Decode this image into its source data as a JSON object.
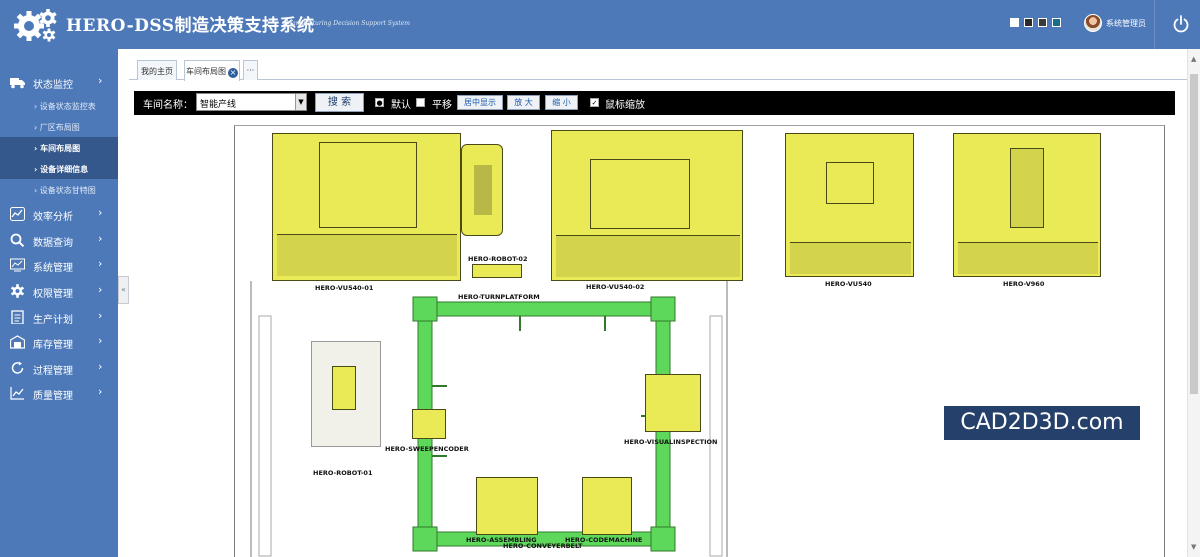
{
  "header": {
    "title": "HERO-DSS制造决策支持系统",
    "subtitle": "Manufacturing Decision Support System",
    "theme_colors": [
      "#ffffff",
      "#2b2b2b",
      "#3b3b3b",
      "#1b6e8a"
    ],
    "user_name": "系统管理员",
    "power_icon": "power-icon",
    "logo_icon": "gears-icon"
  },
  "sidebar": {
    "groups": [
      {
        "label": "状态监控",
        "icon": "truck-icon",
        "expanded": true,
        "children": [
          {
            "label": "› 设备状态监控表",
            "active": false
          },
          {
            "label": "› 厂区布局图",
            "active": false
          },
          {
            "label": "› 车间布局图",
            "active": true
          },
          {
            "label": "› 设备详细信息",
            "active": true
          },
          {
            "label": "› 设备状态甘特图",
            "active": false
          }
        ]
      },
      {
        "label": "效率分析",
        "icon": "chart-icon"
      },
      {
        "label": "数据查询",
        "icon": "search-icon"
      },
      {
        "label": "系统管理",
        "icon": "monitor-chart-icon"
      },
      {
        "label": "权限管理",
        "icon": "gear-icon"
      },
      {
        "label": "生产计划",
        "icon": "clipboard-icon"
      },
      {
        "label": "库存管理",
        "icon": "warehouse-icon"
      },
      {
        "label": "过程管理",
        "icon": "cycle-icon"
      },
      {
        "label": "质量管理",
        "icon": "line-chart-icon"
      }
    ],
    "collapse_glyph": "«",
    "chevron": "›"
  },
  "tabs": [
    {
      "label": "我的主页",
      "selected": false
    },
    {
      "label": "车间布局图",
      "selected": true,
      "close": "×"
    },
    {
      "label": "···",
      "selected": false
    }
  ],
  "toolbar": {
    "workshop_label": "车间名称：",
    "workshop_value": "智能产线",
    "search_button": "搜 索",
    "default_label": "默认",
    "pan_label": "平移",
    "center_button": "居中显示",
    "zoom_in_button": "放 大",
    "zoom_out_button": "缩 小",
    "wheel_zoom_label": "鼠标缩放",
    "default_checked": true,
    "pan_checked": false,
    "wheel_zoom_checked": true
  },
  "layout": {
    "machines": [
      {
        "id": "vu540_01",
        "label": "HERO-VU540-01"
      },
      {
        "id": "robot_02",
        "label": "HERO-ROBOT-02"
      },
      {
        "id": "turnplatform",
        "label": "HERO-TURNPLATFORM"
      },
      {
        "id": "vu540_02",
        "label": "HERO-VU540-02"
      },
      {
        "id": "vu540",
        "label": "HERO-VU540"
      },
      {
        "id": "v960",
        "label": "HERO-V960"
      },
      {
        "id": "sweepencoder",
        "label": "HERO-SWEEPENCODER"
      },
      {
        "id": "robot_01",
        "label": "HERO-ROBOT-01"
      },
      {
        "id": "visualinspection",
        "label": "HERO-VISUALINSPECTION"
      },
      {
        "id": "assembling",
        "label": "HERO-ASSEMBLING"
      },
      {
        "id": "conveyerbelt",
        "label": "HERO-CONVEYERBELT"
      },
      {
        "id": "codemachine",
        "label": "HERO-CODEMACHINE"
      }
    ],
    "machine_color": "#e9ea55",
    "conveyor_color": "#5ed85a"
  },
  "watermark": "CAD2D3D.com"
}
